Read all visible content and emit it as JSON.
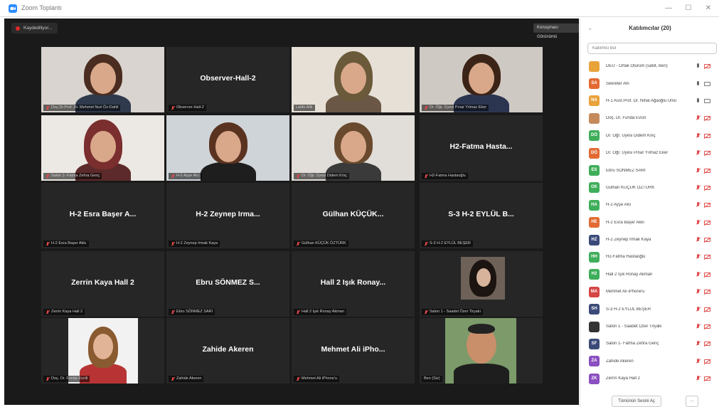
{
  "window": {
    "title": "Zoom Toplantı"
  },
  "meeting": {
    "recording_label": "Kaydediliyor...",
    "view_button": "Konuşmacı Görünümü",
    "tiles": [
      {
        "name": "",
        "label": "Doç.Dr.Prof. Dr. Mehmet Nuri Öz-Dahil",
        "muted": true,
        "video": "man-glasses"
      },
      {
        "name": "Observer-Hall-2",
        "label": "Observer-Hall-2",
        "muted": true,
        "video": "none"
      },
      {
        "name": "",
        "label": "Latife Alik",
        "muted": false,
        "video": "hijab-woman",
        "active": true
      },
      {
        "name": "",
        "label": "Dr. Öğr. Üyesi Pınar Yılmaz Eker",
        "muted": true,
        "video": "woman-hand"
      },
      {
        "name": "",
        "label": "Salon 1- Fatma Zehra Genç",
        "muted": true,
        "video": "hijab-woman-2"
      },
      {
        "name": "",
        "label": "H-2 Ayşe Alcı",
        "muted": true,
        "video": "woman-glasses"
      },
      {
        "name": "",
        "label": "Dr. Öğr. Üyesi Didem Kılıç",
        "muted": true,
        "video": "woman-2"
      },
      {
        "name": "H2-Fatma Hasta...",
        "label": "H2-Fatma Hastaoğlu",
        "muted": true,
        "video": "none"
      },
      {
        "name": "H-2 Esra Başer A...",
        "label": "H-2 Esra Başer Akkı",
        "muted": true,
        "video": "none"
      },
      {
        "name": "H-2 Zeynep Irma...",
        "label": "H-2 Zeynep Irmak Kaya",
        "muted": true,
        "video": "none"
      },
      {
        "name": "Gülhan KÜÇÜK...",
        "label": "Gülhan KÜÇÜK ÖZTÜRK",
        "muted": true,
        "video": "none"
      },
      {
        "name": "S-3 H-2 EYLÜL B...",
        "label": "S-3 H-2 EYLÜL BEŞER",
        "muted": true,
        "video": "none"
      },
      {
        "name": "Zerrin Kaya Hall 2",
        "label": "Zerrin Kaya Hall 2",
        "muted": true,
        "video": "none"
      },
      {
        "name": "Ebru SÖNMEZ S...",
        "label": "Ebru SÖNMEZ SARI",
        "muted": true,
        "video": "none"
      },
      {
        "name": "Hall 2 Işık Ronay...",
        "label": "Hall 2 Işık Ronay Akman",
        "muted": true,
        "video": "none"
      },
      {
        "name": "",
        "label": "Salon 1 - Saadet Özer Tiryaki",
        "muted": true,
        "video": "photo-woman-dark"
      },
      {
        "name": "",
        "label": "Doç. Dr. Funda Evcili",
        "muted": true,
        "video": "photo-woman-blonde"
      },
      {
        "name": "Zahide Akeren",
        "label": "Zahide Akeren",
        "muted": true,
        "video": "none"
      },
      {
        "name": "Mehmet Ali iPho...",
        "label": "Mehmet Ali iPhone'u",
        "muted": true,
        "video": "none"
      },
      {
        "name": "",
        "label": "Ben (Siz)",
        "muted": false,
        "video": "photo-man"
      }
    ]
  },
  "panel": {
    "title": "Katılımcılar (20)",
    "search_placeholder": "Katılımcı bul",
    "participants": [
      {
        "initials": "",
        "name": "DEÜ - Ortak Oturum (sabit, Ben)",
        "color": "#e8a33b",
        "mic": "on",
        "cam": "off",
        "avatar": "photo"
      },
      {
        "initials": "SA",
        "name": "Sekreter Ahi",
        "color": "#e26a32",
        "mic": "on",
        "cam": "on"
      },
      {
        "initials": "NA",
        "name": "H-1 Asst.Prof. Dr. Nihal Ağaoğlu Ünlü",
        "color": "#e8a33b",
        "mic": "on",
        "cam": "on"
      },
      {
        "initials": "",
        "name": "Doç. Dr. Funda Evcili",
        "color": "#c48a5c",
        "mic": "off",
        "cam": "off",
        "avatar": "photo"
      },
      {
        "initials": "DÖ",
        "name": "Dr. Öğr. Üyesi Didem Kılıç",
        "color": "#3fae5a",
        "mic": "off",
        "cam": "off"
      },
      {
        "initials": "DÖ",
        "name": "Dr. Öğr. Üyesi Pınar Yılmaz Eker",
        "color": "#e26a32",
        "mic": "off",
        "cam": "off"
      },
      {
        "initials": "ES",
        "name": "Ebru SÖNMEZ SARI",
        "color": "#3fae5a",
        "mic": "off",
        "cam": "off"
      },
      {
        "initials": "GK",
        "name": "Gülhan KÜÇÜK ÖZTÜRK",
        "color": "#3fae5a",
        "mic": "off",
        "cam": "off"
      },
      {
        "initials": "HA",
        "name": "H-2 Ayşe Alcı",
        "color": "#3fae5a",
        "mic": "off",
        "cam": "off"
      },
      {
        "initials": "HE",
        "name": "H-2 Esra Başer Akkı",
        "color": "#e26a32",
        "mic": "off",
        "cam": "off"
      },
      {
        "initials": "HZ",
        "name": "H-2 Zeynep Irmak Kaya",
        "color": "#3b4a78",
        "mic": "off",
        "cam": "off"
      },
      {
        "initials": "HH",
        "name": "H2-Fatma Hastaoğlu",
        "color": "#3fae5a",
        "mic": "off",
        "cam": "off"
      },
      {
        "initials": "H2",
        "name": "Hall 2 Işık Ronay Akman",
        "color": "#3fae5a",
        "mic": "off",
        "cam": "off"
      },
      {
        "initials": "MA",
        "name": "Mehmet Ali iPhone'u",
        "color": "#d64545",
        "mic": "off",
        "cam": "off"
      },
      {
        "initials": "SH",
        "name": "S-3 H-2 EYLÜL BEŞER",
        "color": "#3b4a78",
        "mic": "off",
        "cam": "off"
      },
      {
        "initials": "",
        "name": "Salon 1 - Saadet Özer Tiryaki",
        "color": "#333333",
        "mic": "off",
        "cam": "off",
        "avatar": "photo"
      },
      {
        "initials": "SF",
        "name": "Salon 1- Fatma Zehra Genç",
        "color": "#3b4a78",
        "mic": "off",
        "cam": "off"
      },
      {
        "initials": "ZA",
        "name": "Zahide Akeren",
        "color": "#8a4fc0",
        "mic": "off",
        "cam": "off"
      },
      {
        "initials": "ZK",
        "name": "Zerrin Kaya Hall 2",
        "color": "#8a4fc0",
        "mic": "off",
        "cam": "off"
      }
    ],
    "invite_label": "Tümünün Sesini Aç",
    "more_label": "..."
  }
}
